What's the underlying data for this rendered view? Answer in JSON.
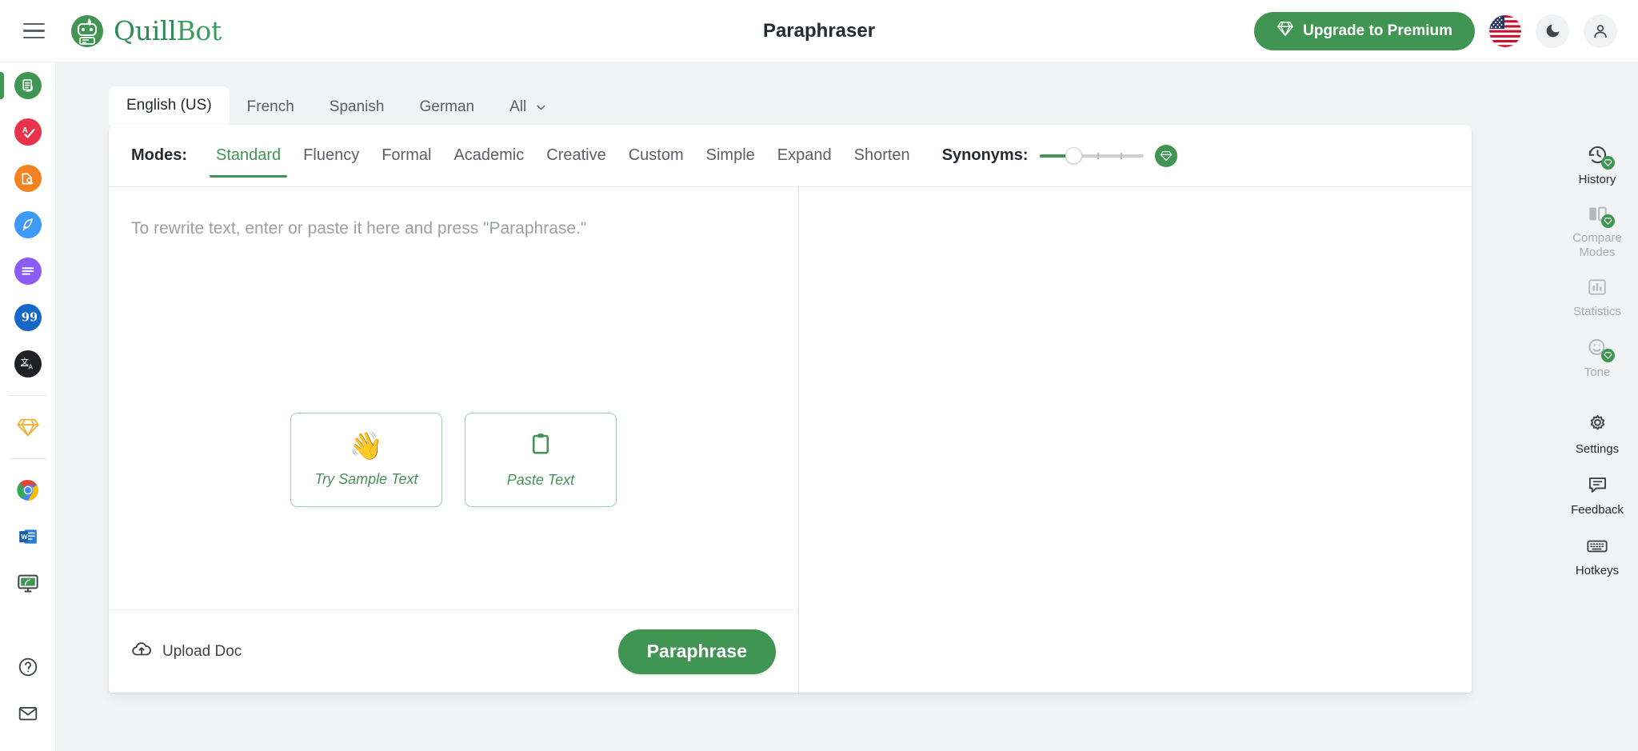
{
  "header": {
    "menu_icon": "hamburger-menu-icon",
    "logo_text_part1": "Quill",
    "logo_text_part2": "Bot",
    "title": "Paraphraser",
    "upgrade_label": "Upgrade to Premium",
    "upgrade_icon": "diamond-icon",
    "flag_icon": "us-flag-icon",
    "theme_icon": "moon-dark-mode-icon",
    "account_icon": "user-account-icon"
  },
  "sidebar": {
    "items": [
      {
        "name": "paraphraser",
        "icon": "paraphraser-icon",
        "color": "#3f9551",
        "active": true
      },
      {
        "name": "grammar-checker",
        "icon": "grammar-checker-icon",
        "color": "#e8334a",
        "active": false
      },
      {
        "name": "plagiarism-checker",
        "icon": "plagiarism-checker-icon",
        "color": "#f58220",
        "active": false
      },
      {
        "name": "co-writer",
        "icon": "co-writer-quill-icon",
        "color": "#3d9bf5",
        "active": false
      },
      {
        "name": "summarizer",
        "icon": "summarizer-icon",
        "color": "#8b5cf6",
        "active": false
      },
      {
        "name": "citation-generator",
        "icon": "quotes-citation-icon",
        "color": "#1668c7",
        "active": false
      },
      {
        "name": "translator",
        "icon": "translator-icon",
        "color": "#202124",
        "active": false
      }
    ],
    "premium": {
      "name": "premium",
      "icon": "gold-diamond-icon",
      "color": "#f2b33d"
    },
    "apps": [
      {
        "name": "chrome-extension",
        "icon": "chrome-icon"
      },
      {
        "name": "word-addin",
        "icon": "microsoft-word-icon"
      },
      {
        "name": "desktop-app",
        "icon": "desktop-monitor-icon"
      }
    ],
    "help": [
      {
        "name": "help",
        "icon": "help-question-icon"
      },
      {
        "name": "contact",
        "icon": "mail-envelope-icon"
      }
    ]
  },
  "language_tabs": {
    "items": [
      "English (US)",
      "French",
      "Spanish",
      "German",
      "All"
    ],
    "active_index": 0,
    "dropdown_icon": "chevron-down-icon"
  },
  "modes": {
    "label": "Modes:",
    "items": [
      "Standard",
      "Fluency",
      "Formal",
      "Academic",
      "Creative",
      "Custom",
      "Simple",
      "Expand",
      "Shorten"
    ],
    "active": "Standard",
    "synonyms_label": "Synonyms:",
    "synonyms_value": 25,
    "synonyms_premium_icon": "diamond-icon",
    "accent_color": "#3f9551"
  },
  "input_pane": {
    "placeholder": "To rewrite text, enter or paste it here and press \"Paraphrase.\"",
    "quick_actions": [
      {
        "label": "Try Sample Text",
        "icon": "waving-hand-emoji",
        "glyph": "👋"
      },
      {
        "label": "Paste Text",
        "icon": "clipboard-icon",
        "glyph": ""
      }
    ],
    "upload_label": "Upload Doc",
    "upload_icon": "cloud-upload-icon",
    "paraphrase_label": "Paraphrase"
  },
  "output_pane": {
    "content": ""
  },
  "right_rail": {
    "items": [
      {
        "label": "History",
        "icon": "history-clock-icon",
        "premium": true,
        "dim": false
      },
      {
        "label": "Compare Modes",
        "icon": "compare-modes-icon",
        "premium": true,
        "dim": true
      },
      {
        "label": "Statistics",
        "icon": "statistics-bar-chart-icon",
        "premium": false,
        "dim": true
      },
      {
        "label": "Tone",
        "icon": "tone-smiley-icon",
        "premium": true,
        "dim": true
      },
      {
        "label": "Settings",
        "icon": "gear-settings-icon",
        "premium": false,
        "dim": false
      },
      {
        "label": "Feedback",
        "icon": "feedback-chat-icon",
        "premium": false,
        "dim": false
      },
      {
        "label": "Hotkeys",
        "icon": "keyboard-hotkeys-icon",
        "premium": false,
        "dim": false
      }
    ]
  }
}
